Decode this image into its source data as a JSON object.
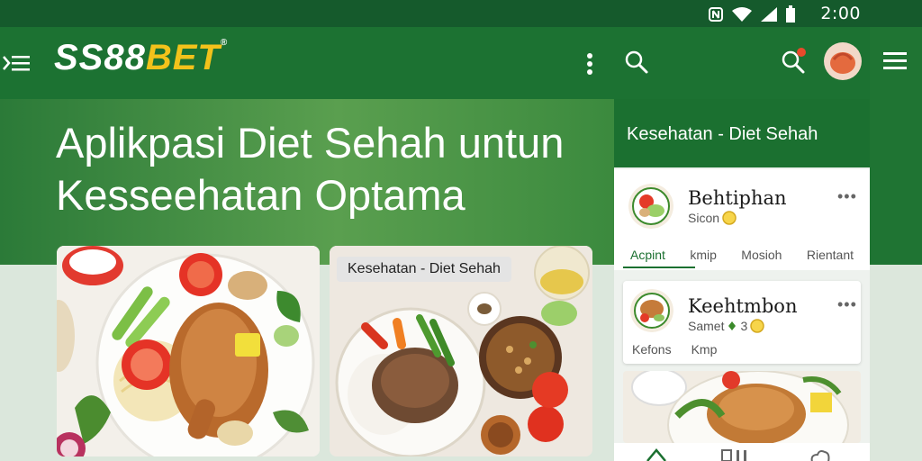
{
  "status": {
    "time": "2:00"
  },
  "app": {
    "logo_main": "SS88",
    "logo_accent": "BET",
    "logo_mark": "®"
  },
  "hero": {
    "title_line1": "Aplikpasi Diet Sehah untun",
    "title_line2": "Kesseehatan Optama"
  },
  "cards": [
    {
      "chip": ""
    },
    {
      "chip": "Kesehatan - Diet Sehah"
    }
  ],
  "panel": {
    "title": "Kesehatan - Diet Sehah",
    "profiles": [
      {
        "name": "Behtiphan",
        "sub": "Sicon",
        "tabs": [
          "Acpint",
          "kmip",
          "Mosioh",
          "Rientant"
        ]
      },
      {
        "name": "Keehtmbon",
        "sub": "Samet",
        "sub_count": "3",
        "tabs": [
          "Kefons",
          "Kmp"
        ]
      }
    ],
    "more": "•••"
  },
  "icons": [
    "menu-icon",
    "kebab-icon",
    "search-icon",
    "notification-search-icon",
    "avatar",
    "hamburger-icon",
    "wifi-icon",
    "signal-icon",
    "battery-icon",
    "nfc-icon"
  ],
  "colors": {
    "primary": "#1c7232",
    "status": "#155a2c",
    "accent": "#f2c21b"
  }
}
